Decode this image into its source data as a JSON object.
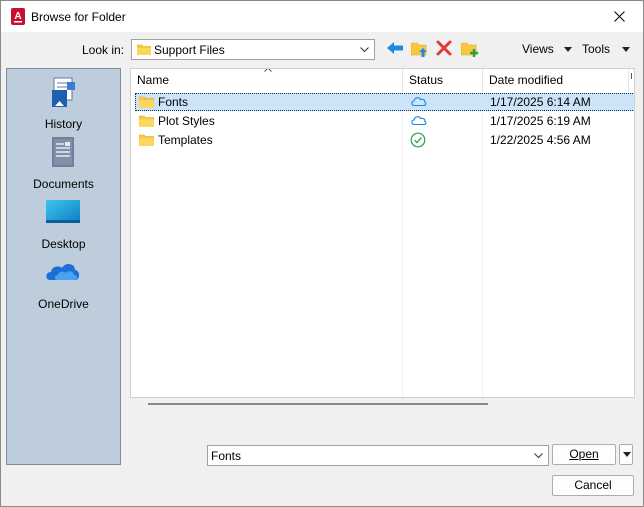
{
  "window": {
    "title": "Browse for Folder",
    "app_icon_letter": "A"
  },
  "toolbar": {
    "look_in_label": "Look in:",
    "look_in_value": "Support Files",
    "views_label": "Views",
    "tools_label": "Tools"
  },
  "places": [
    {
      "label": "History",
      "icon": "history-icon"
    },
    {
      "label": "Documents",
      "icon": "documents-icon"
    },
    {
      "label": "Desktop",
      "icon": "desktop-icon"
    },
    {
      "label": "OneDrive",
      "icon": "onedrive-icon"
    }
  ],
  "file_list": {
    "columns": [
      "Name",
      "Status",
      "Date modified"
    ],
    "rows": [
      {
        "name": "Fonts",
        "status": "cloud",
        "date": "1/17/2025 6:14 AM",
        "selected": true
      },
      {
        "name": "Plot Styles",
        "status": "cloud",
        "date": "1/17/2025 6:19 AM",
        "selected": false
      },
      {
        "name": "Templates",
        "status": "synced",
        "date": "1/22/2025 4:56 AM",
        "selected": false
      }
    ]
  },
  "footer": {
    "folder_name_value": "Fonts",
    "open_label": "Open",
    "cancel_label": "Cancel"
  },
  "colors": {
    "places_bg": "#bdcddc",
    "selection_bg": "#cce4f7",
    "folder_yellow": "#f8c93e",
    "accent_blue": "#1e88e5",
    "delete_red": "#e53935",
    "synced_green": "#2e9b45",
    "app_red": "#c8102e"
  }
}
